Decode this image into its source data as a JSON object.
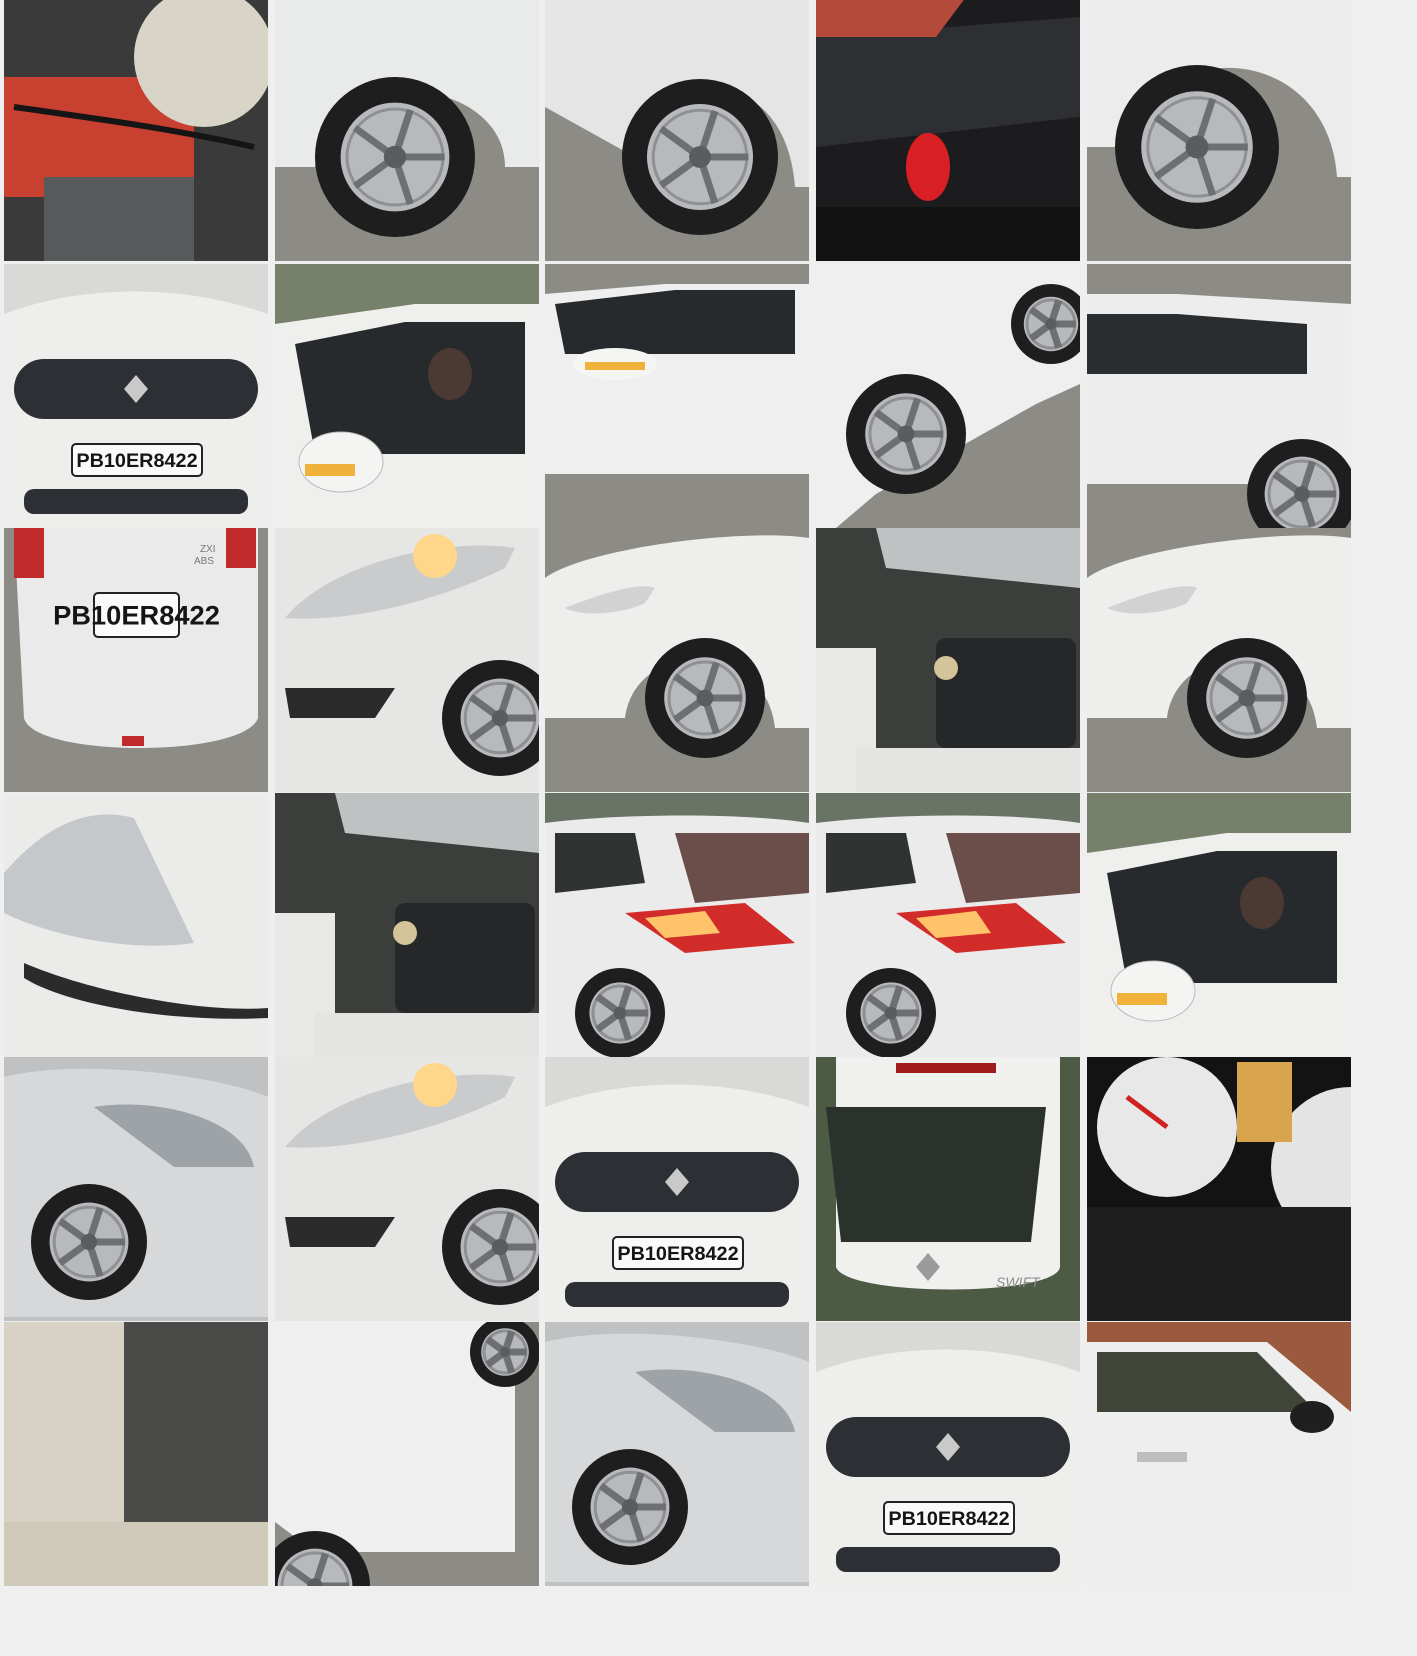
{
  "gallery": {
    "rows": 6,
    "columns": 5,
    "tiles": [
      {
        "subject": "engine-battery"
      },
      {
        "subject": "front-wheel"
      },
      {
        "subject": "rear-wheel"
      },
      {
        "subject": "interior-door"
      },
      {
        "subject": "front-wheel-side"
      },
      {
        "subject": "front-grille-plate",
        "plate": "PB10ER8422"
      },
      {
        "subject": "side-mirror-window"
      },
      {
        "subject": "side-door-mirror"
      },
      {
        "subject": "side-wheels"
      },
      {
        "subject": "rear-side-door"
      },
      {
        "subject": "rear-plate",
        "plate": "PB10ER8422",
        "badge_top": "ZXI",
        "badge_bottom": "ABS"
      },
      {
        "subject": "headlight-on"
      },
      {
        "subject": "front-quarter"
      },
      {
        "subject": "engine-bay"
      },
      {
        "subject": "front-quarter"
      },
      {
        "subject": "headlight-close"
      },
      {
        "subject": "engine-bay"
      },
      {
        "subject": "rear-quarter-taillight"
      },
      {
        "subject": "rear-quarter-taillight"
      },
      {
        "subject": "side-mirror-window"
      },
      {
        "subject": "front-quarter-grey"
      },
      {
        "subject": "headlight-on"
      },
      {
        "subject": "front-grille-plate",
        "plate": "PB10ER8422"
      },
      {
        "subject": "rear-windshield",
        "badge": "SWIFT"
      },
      {
        "subject": "instrument-cluster"
      },
      {
        "subject": "engine-stamp"
      },
      {
        "subject": "side-panel-wheel"
      },
      {
        "subject": "front-quarter-grey"
      },
      {
        "subject": "front-grille-plate",
        "plate": "PB10ER8422"
      },
      {
        "subject": "front-door-interior"
      }
    ]
  }
}
